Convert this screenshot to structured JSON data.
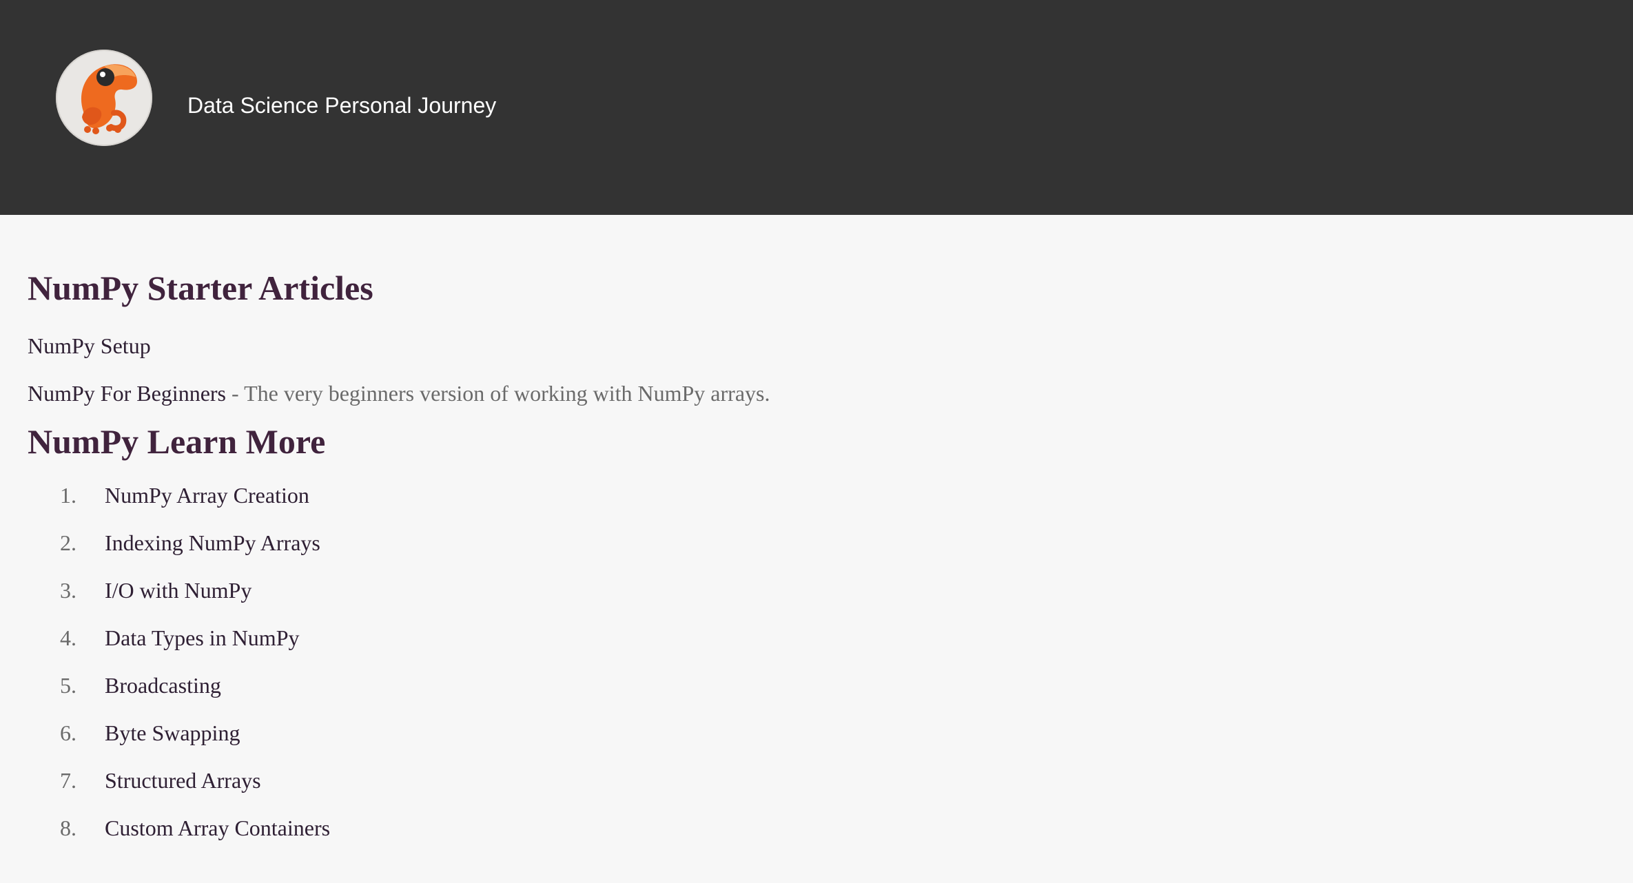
{
  "header": {
    "logo_icon": "frog-logo-icon",
    "site_title": "Data Science Personal Journey"
  },
  "starter": {
    "heading": "NumPy Starter Articles",
    "items": [
      {
        "label": "NumPy Setup",
        "description": ""
      },
      {
        "label": "NumPy For Beginners",
        "description": " - The very beginners version of working with NumPy arrays."
      }
    ]
  },
  "learn_more": {
    "heading": "NumPy Learn More",
    "items": [
      {
        "number": "1.",
        "label": "NumPy Array Creation"
      },
      {
        "number": "2.",
        "label": "Indexing NumPy Arrays"
      },
      {
        "number": "3.",
        "label": "I/O with NumPy"
      },
      {
        "number": "4.",
        "label": "Data Types in NumPy"
      },
      {
        "number": "5.",
        "label": "Broadcasting"
      },
      {
        "number": "6.",
        "label": "Byte Swapping"
      },
      {
        "number": "7.",
        "label": "Structured Arrays"
      },
      {
        "number": "8.",
        "label": "Custom Array Containers"
      }
    ]
  },
  "colors": {
    "header_bg": "#333333",
    "page_bg": "#f7f7f7",
    "heading": "#40233d",
    "link": "#2f2034",
    "muted": "#6a6a6a",
    "logo_orange": "#ee6a1f"
  }
}
